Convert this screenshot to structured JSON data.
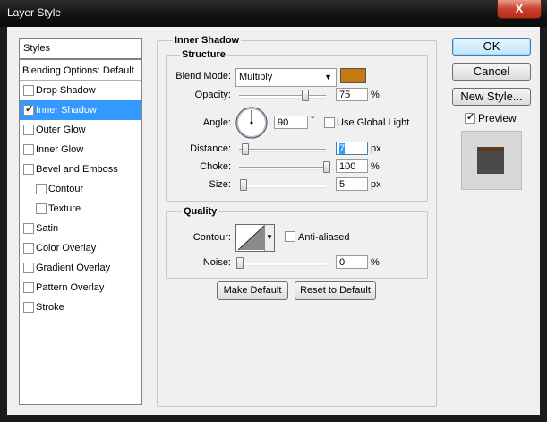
{
  "window": {
    "title": "Layer Style",
    "close_glyph": "X"
  },
  "styles_header": "Styles",
  "blending_options": "Blending Options: Default",
  "style_items": [
    {
      "label": "Drop Shadow",
      "checked": false,
      "selected": false
    },
    {
      "label": "Inner Shadow",
      "checked": true,
      "selected": true
    },
    {
      "label": "Outer Glow",
      "checked": false,
      "selected": false
    },
    {
      "label": "Inner Glow",
      "checked": false,
      "selected": false
    },
    {
      "label": "Bevel and Emboss",
      "checked": false,
      "selected": false
    },
    {
      "label": "Contour",
      "checked": false,
      "selected": false
    },
    {
      "label": "Texture",
      "checked": false,
      "selected": false
    },
    {
      "label": "Satin",
      "checked": false,
      "selected": false
    },
    {
      "label": "Color Overlay",
      "checked": false,
      "selected": false
    },
    {
      "label": "Gradient Overlay",
      "checked": false,
      "selected": false
    },
    {
      "label": "Pattern Overlay",
      "checked": false,
      "selected": false
    },
    {
      "label": "Stroke",
      "checked": false,
      "selected": false
    }
  ],
  "inner_shadow": {
    "title": "Inner Shadow",
    "structure": {
      "title": "Structure",
      "blend_mode_label": "Blend Mode:",
      "blend_mode_value": "Multiply",
      "shadow_color": "#c47a0e",
      "opacity_label": "Opacity:",
      "opacity_value": "75",
      "opacity_unit": "%",
      "opacity_level": 75,
      "angle_label": "Angle:",
      "angle_value": "90",
      "angle_unit": "°",
      "use_global_light_label": "Use Global Light",
      "use_global_light": false,
      "distance_label": "Distance:",
      "distance_value": "7",
      "distance_unit": "px",
      "choke_label": "Choke:",
      "choke_value": "100",
      "choke_unit": "%",
      "choke_level": 100,
      "size_label": "Size:",
      "size_value": "5",
      "size_unit": "px"
    },
    "quality": {
      "title": "Quality",
      "contour_label": "Contour:",
      "anti_aliased_label": "Anti-aliased",
      "anti_aliased": false,
      "noise_label": "Noise:",
      "noise_value": "0",
      "noise_unit": "%"
    },
    "make_default_label": "Make Default",
    "reset_default_label": "Reset to Default"
  },
  "buttons": {
    "ok": "OK",
    "cancel": "Cancel",
    "new_style": "New Style..."
  },
  "preview": {
    "label": "Preview",
    "checked": true
  }
}
